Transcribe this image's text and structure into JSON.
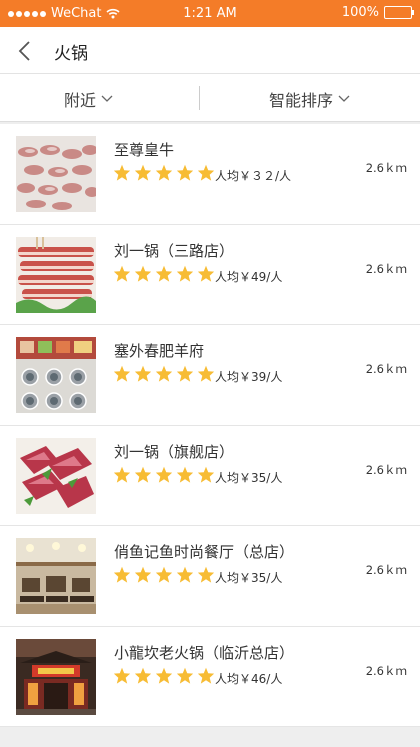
{
  "status": {
    "carrier": "WeChat",
    "time": "1:21 AM",
    "battery": "100%"
  },
  "nav": {
    "title": "火锅"
  },
  "filters": {
    "nearby": "附近",
    "sort": "智能排序"
  },
  "colors": {
    "accent": "#f47c28",
    "star": "#f7bc34"
  },
  "restaurants": [
    {
      "name": "至尊皇牛",
      "price": "人均￥３２/人",
      "distance": "2.6ｋｍ",
      "rating": 5
    },
    {
      "name": "刘一锅（三路店）",
      "price": "人均￥49/人",
      "distance": "2.6ｋｍ",
      "rating": 5
    },
    {
      "name": "塞外春肥羊府",
      "price": "人均￥39/人",
      "distance": "2.6ｋｍ",
      "rating": 5
    },
    {
      "name": "刘一锅（旗舰店）",
      "price": "人均￥35/人",
      "distance": "2.6ｋｍ",
      "rating": 5
    },
    {
      "name": "俏鱼记鱼时尚餐厅（总店）",
      "price": "人均￥35/人",
      "distance": "2.6ｋｍ",
      "rating": 5
    },
    {
      "name": "小龍坎老火锅（临沂总店）",
      "price": "人均￥46/人",
      "distance": "2.6ｋｍ",
      "rating": 5
    }
  ]
}
